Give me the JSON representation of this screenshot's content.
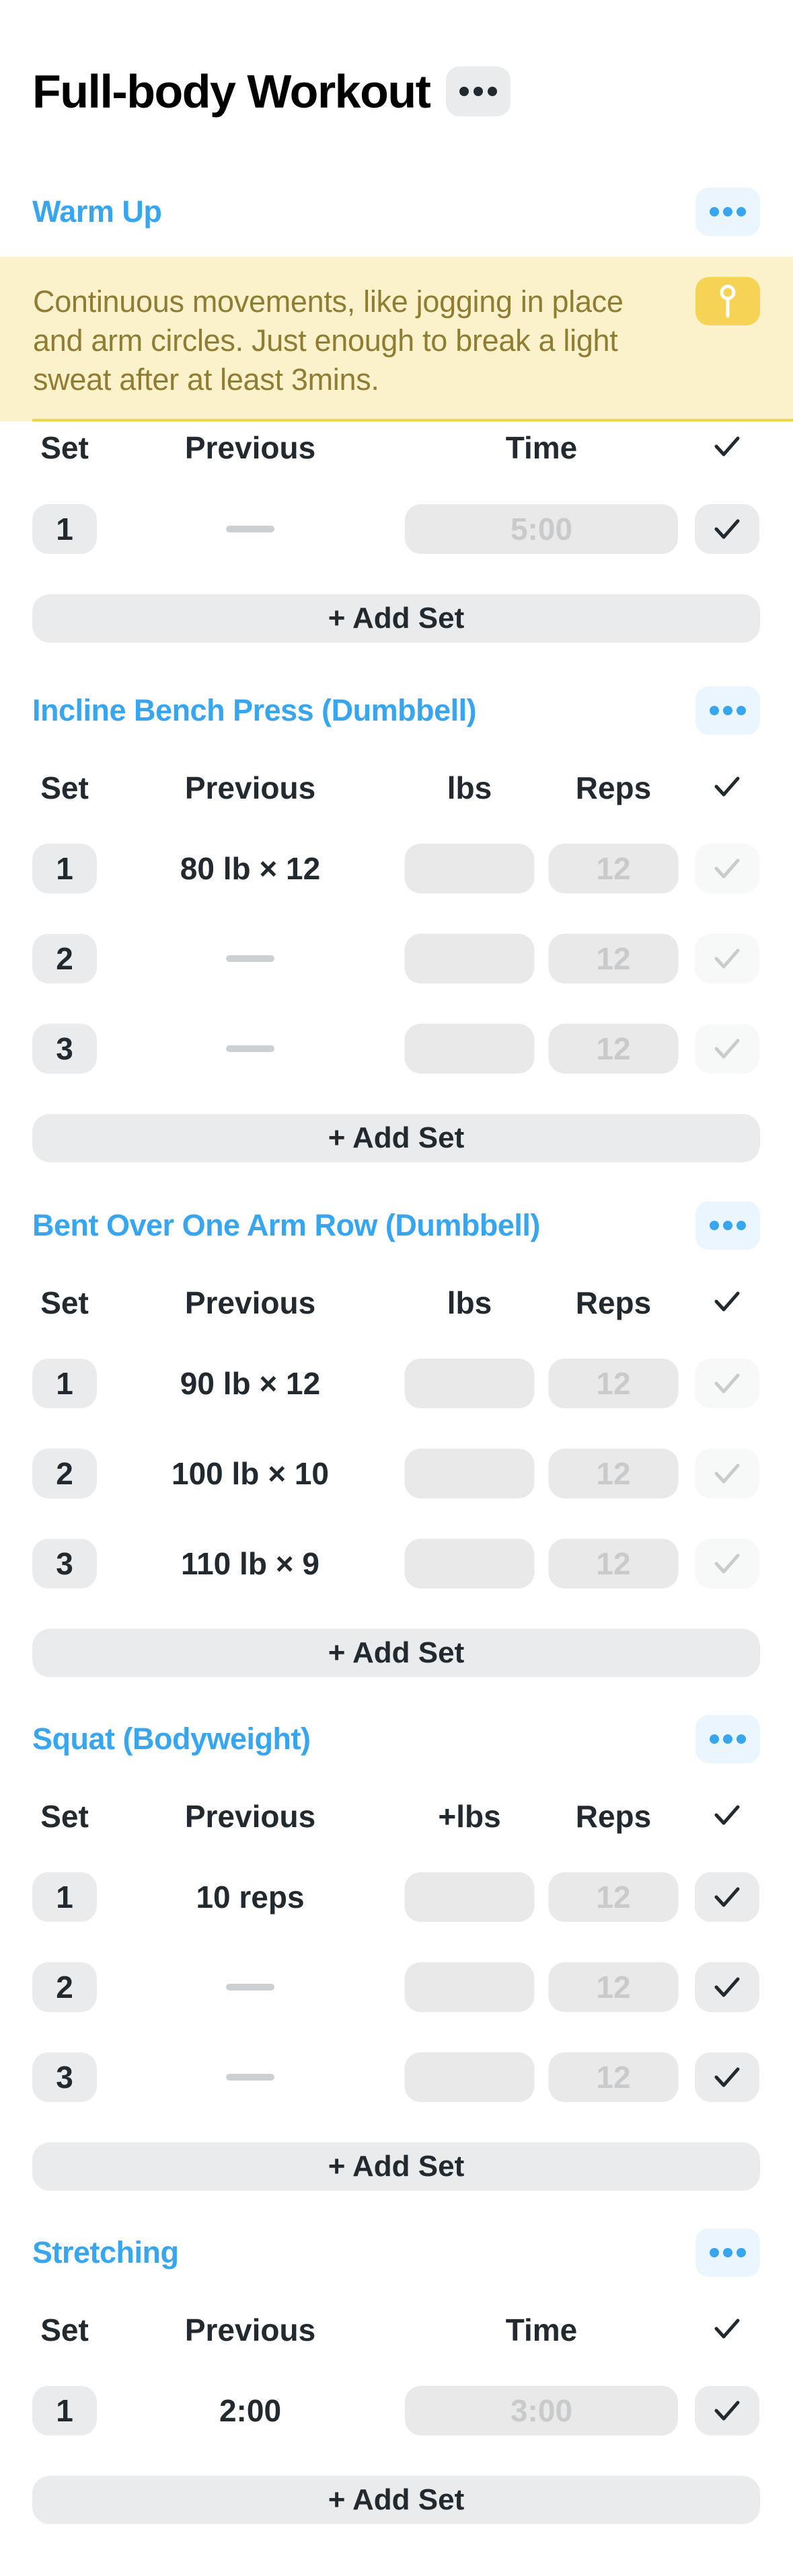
{
  "header": {
    "title": "Full-body Workout",
    "menu_icon": "ellipsis-icon"
  },
  "colors": {
    "accent": "#38a5ef",
    "accent_bg": "#eaf5fe",
    "note_bg": "#fbf1ca",
    "note_text": "#8f7d33",
    "note_accent": "#f6d255",
    "pill_bg": "#e9ebec",
    "text": "#22292f"
  },
  "add_set_label": "+ Add Set",
  "sections": [
    {
      "title": "Warm Up",
      "type": "time",
      "note": {
        "text": "Continuous movements, like jogging in place and arm circles. Just enough to break a light sweat after at least 3mins.",
        "icon": "pin-icon"
      },
      "columns": {
        "set": "Set",
        "previous": "Previous",
        "time": "Time",
        "done": "✓"
      },
      "rows": [
        {
          "set": "1",
          "previous": "",
          "time_placeholder": "5:00",
          "check_active": true
        }
      ]
    },
    {
      "title": "Incline Bench Press (Dumbbell)",
      "type": "weight",
      "columns": {
        "set": "Set",
        "previous": "Previous",
        "weight": "lbs",
        "reps": "Reps",
        "done": "✓"
      },
      "rows": [
        {
          "set": "1",
          "previous": "80 lb × 12",
          "weight": "",
          "reps_placeholder": "12",
          "check_active": false
        },
        {
          "set": "2",
          "previous": "",
          "weight": "",
          "reps_placeholder": "12",
          "check_active": false
        },
        {
          "set": "3",
          "previous": "",
          "weight": "",
          "reps_placeholder": "12",
          "check_active": false
        }
      ]
    },
    {
      "title": "Bent Over One Arm Row (Dumbbell)",
      "type": "weight",
      "columns": {
        "set": "Set",
        "previous": "Previous",
        "weight": "lbs",
        "reps": "Reps",
        "done": "✓"
      },
      "rows": [
        {
          "set": "1",
          "previous": "90 lb × 12",
          "weight": "",
          "reps_placeholder": "12",
          "check_active": false
        },
        {
          "set": "2",
          "previous": "100 lb × 10",
          "weight": "",
          "reps_placeholder": "12",
          "check_active": false
        },
        {
          "set": "3",
          "previous": "110 lb × 9",
          "weight": "",
          "reps_placeholder": "12",
          "check_active": false
        }
      ]
    },
    {
      "title": "Squat (Bodyweight)",
      "type": "weight",
      "columns": {
        "set": "Set",
        "previous": "Previous",
        "weight": "+lbs",
        "reps": "Reps",
        "done": "✓"
      },
      "rows": [
        {
          "set": "1",
          "previous": "10 reps",
          "weight": "",
          "reps_placeholder": "12",
          "check_active": true
        },
        {
          "set": "2",
          "previous": "",
          "weight": "",
          "reps_placeholder": "12",
          "check_active": true
        },
        {
          "set": "3",
          "previous": "",
          "weight": "",
          "reps_placeholder": "12",
          "check_active": true
        }
      ]
    },
    {
      "title": "Stretching",
      "type": "time",
      "columns": {
        "set": "Set",
        "previous": "Previous",
        "time": "Time",
        "done": "✓"
      },
      "rows": [
        {
          "set": "1",
          "previous": "2:00",
          "time_placeholder": "3:00",
          "check_active": true
        }
      ]
    }
  ]
}
